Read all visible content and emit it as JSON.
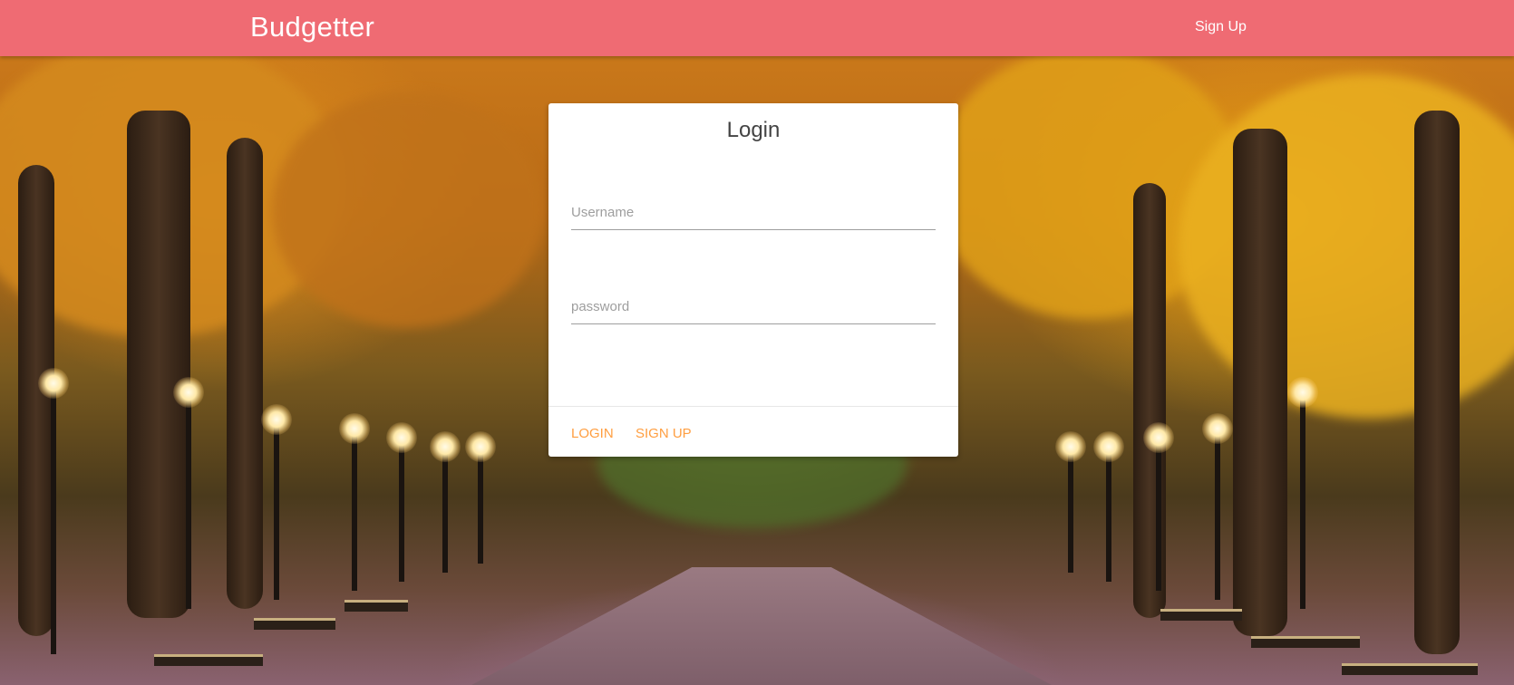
{
  "navbar": {
    "brand": "Budgetter",
    "signup_link": "Sign Up",
    "color": "#ef6b73"
  },
  "login_card": {
    "title": "Login",
    "username_placeholder": "Username",
    "password_placeholder": "password",
    "login_button": "LOGIN",
    "signup_button": "SIGN UP",
    "action_color": "#ff9e40"
  },
  "background": {
    "description_icon": "autumn-park-photo"
  }
}
